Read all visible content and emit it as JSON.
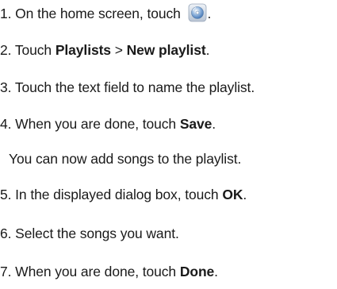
{
  "steps": [
    {
      "num": "1.",
      "text": "On the home screen, touch",
      "suffix": ".",
      "icon": "music-player-app-icon"
    },
    {
      "num": "2.",
      "pre": "Touch ",
      "bold1": "Playlists",
      "mid": " > ",
      "bold2": "New playlist",
      "post": "."
    },
    {
      "num": "3.",
      "text": "Touch the text field to name the playlist."
    },
    {
      "num": "4.",
      "pre": "When you are done, touch ",
      "bold": "Save",
      "post": "."
    },
    {
      "note": "You can now add songs to the playlist."
    },
    {
      "num": "5.",
      "pre": "In the displayed dialog box, touch ",
      "bold": "OK",
      "post": "."
    },
    {
      "num": "6.",
      "text": "Select the songs you want."
    },
    {
      "num": "7.",
      "pre": "When you are done, touch ",
      "bold": "Done",
      "post": "."
    }
  ],
  "colors": {
    "text": "#1a1a1a",
    "icon_bg": "#cfd8e3",
    "icon_accent": "#3a6fb0"
  }
}
